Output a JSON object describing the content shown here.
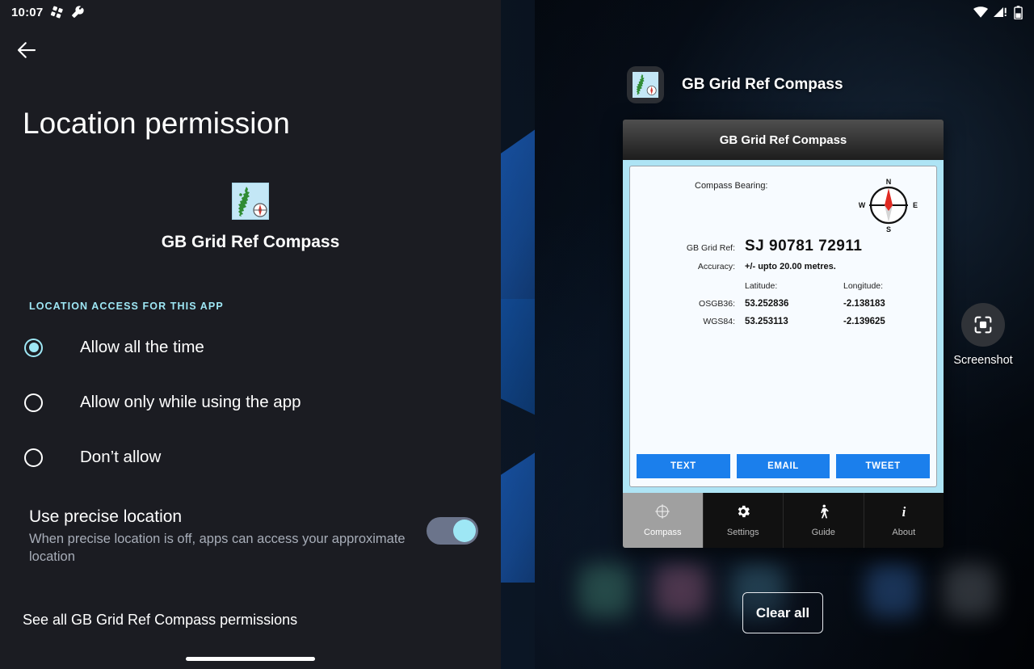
{
  "left": {
    "status_bar": {
      "clock": "10:07",
      "icons": [
        "puzzle-icon",
        "wrench-icon"
      ]
    },
    "back_button": "back-arrow-icon",
    "page_title": "Location permission",
    "app": {
      "icon": "gb-grid-ref-compass-icon",
      "name": "GB Grid Ref Compass"
    },
    "section_label": "LOCATION ACCESS FOR THIS APP",
    "options": [
      {
        "label": "Allow all the time",
        "selected": true
      },
      {
        "label": "Allow only while using the app",
        "selected": false
      },
      {
        "label": "Don’t allow",
        "selected": false
      }
    ],
    "precise": {
      "title": "Use precise location",
      "description": "When precise location is off, apps can access your approximate location",
      "toggle_on": true
    },
    "see_all_link": "See all GB Grid Ref Compass permissions"
  },
  "right": {
    "status_bar": {
      "icons": [
        "wifi-icon",
        "cellular-alert-icon",
        "battery-icon"
      ]
    },
    "card_header": {
      "icon": "gb-grid-ref-compass-icon",
      "title": "GB Grid Ref Compass"
    },
    "app_card": {
      "titlebar": "GB Grid Ref Compass",
      "bearing_label": "Compass Bearing:",
      "bearing_value": "",
      "compass": {
        "north": "N",
        "east": "E",
        "south": "S",
        "west": "W"
      },
      "grid_ref_label": "GB Grid Ref:",
      "grid_ref_value": "SJ  90781  72911",
      "accuracy_label": "Accuracy:",
      "accuracy_value": "+/- upto 20.00 metres.",
      "coord_headers": {
        "lat": "Latitude:",
        "lon": "Longitude:"
      },
      "coord_rows": [
        {
          "system": "OSGB36:",
          "lat": "53.252836",
          "lon": "-2.138183"
        },
        {
          "system": "WGS84:",
          "lat": "53.253113",
          "lon": "-2.139625"
        }
      ],
      "share_buttons": [
        "TEXT",
        "EMAIL",
        "TWEET"
      ],
      "tabs": [
        {
          "label": "Compass",
          "icon": "crosshair-icon",
          "active": true
        },
        {
          "label": "Settings",
          "icon": "gear-icon",
          "active": false
        },
        {
          "label": "Guide",
          "icon": "walking-icon",
          "active": false
        },
        {
          "label": "About",
          "icon": "info-italic-icon",
          "active": false
        }
      ]
    },
    "screenshot_action": {
      "label": "Screenshot",
      "icon": "screenshot-icon"
    },
    "clear_all_button": "Clear all"
  },
  "colors": {
    "accent": "#9ee7f5",
    "app_button_blue": "#1b7fec",
    "left_background": "#1b1c22",
    "card_body_border": "#aee4f5"
  }
}
